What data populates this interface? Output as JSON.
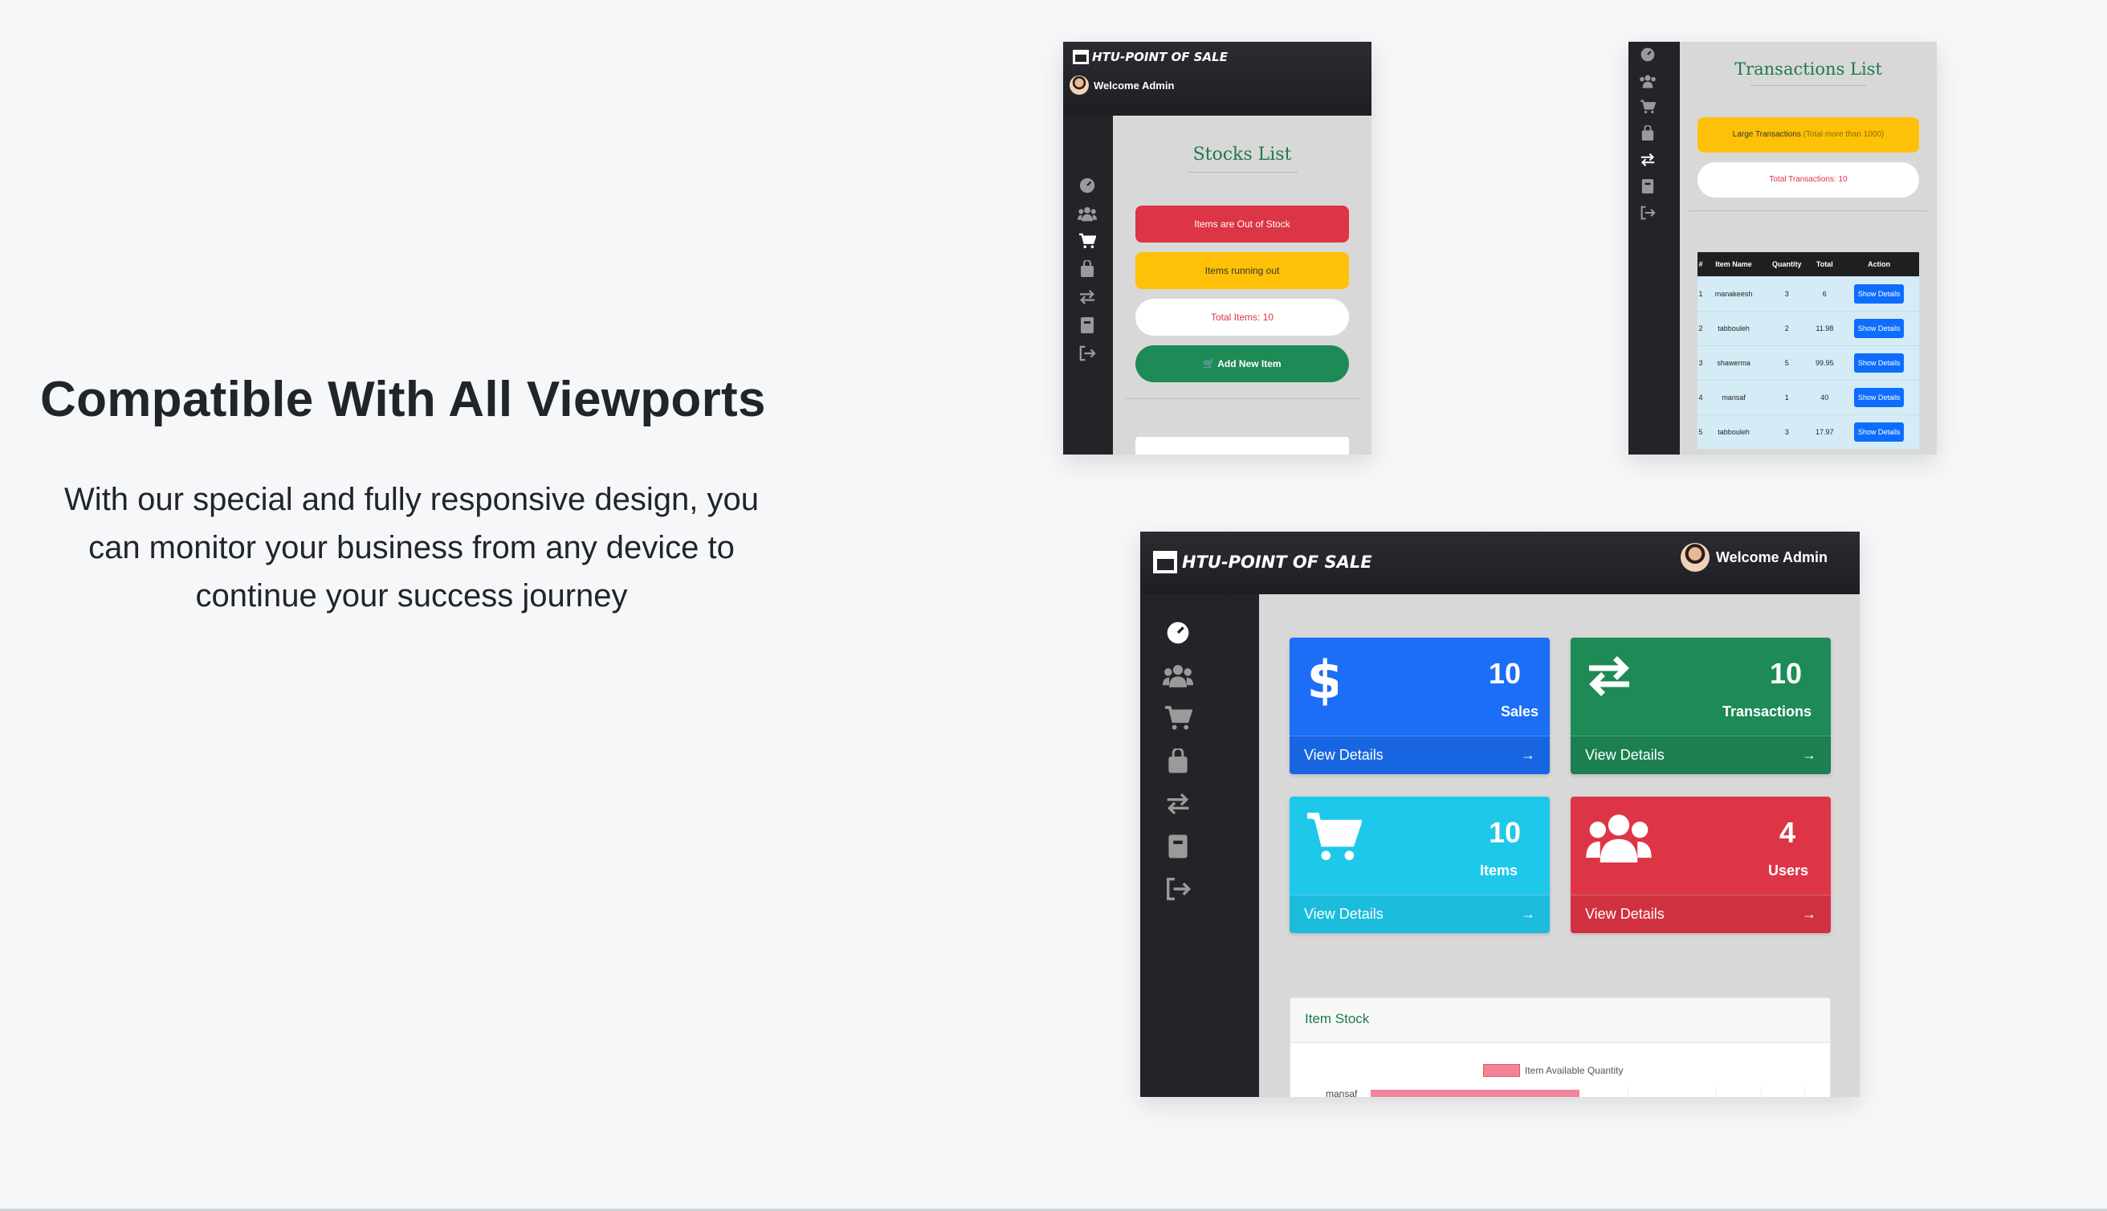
{
  "hero": {
    "title": "Compatible With All Viewports",
    "text": "With our special and fully responsive design, you can monitor your business from any device to continue your success journey"
  },
  "app": {
    "brand": "HTU-POINT OF SALE",
    "welcome": "Welcome Admin"
  },
  "stocks": {
    "title": "Stocks List",
    "out_of_stock": "Items are Out of Stock",
    "running_out": "Items running out",
    "total_items": "Total Items: 10",
    "add_new": "Add New Item"
  },
  "transactions": {
    "title": "Transactions List",
    "large": "Large Transactions",
    "large_note": "(Total more than 1000)",
    "total": "Total Transactions: 10",
    "columns": [
      "#",
      "Item Name",
      "Quantity",
      "Total",
      "Action"
    ],
    "rows": [
      {
        "n": "1",
        "name": "manakeesh",
        "qty": "3",
        "total": "6",
        "action": "Show Details"
      },
      {
        "n": "2",
        "name": "tabbouleh",
        "qty": "2",
        "total": "11.98",
        "action": "Show Details"
      },
      {
        "n": "3",
        "name": "shawerma",
        "qty": "5",
        "total": "99.95",
        "action": "Show Details"
      },
      {
        "n": "4",
        "name": "mansaf",
        "qty": "1",
        "total": "40",
        "action": "Show Details"
      },
      {
        "n": "5",
        "name": "tabbouleh",
        "qty": "3",
        "total": "17.97",
        "action": "Show Details"
      }
    ]
  },
  "dashboard": {
    "cards": [
      {
        "value": "10",
        "label": "Sales",
        "link": "View Details",
        "color": "#1b6ef5",
        "icon": "dollar-icon"
      },
      {
        "value": "10",
        "label": "Transactions",
        "link": "View Details",
        "color": "#1e8a56",
        "icon": "exchange-icon"
      },
      {
        "value": "10",
        "label": "Items",
        "link": "View Details",
        "color": "#1ec8eb",
        "icon": "cart-icon"
      },
      {
        "value": "4",
        "label": "Users",
        "link": "View Details",
        "color": "#dd3545",
        "icon": "users-icon"
      }
    ],
    "stock_panel": {
      "title": "Item Stock",
      "legend": "Item Available Quantity",
      "first_label": "mansaf"
    }
  },
  "colors": {
    "sidebar": "#222427",
    "danger": "#dc3545",
    "warning": "#ffc107",
    "success": "#198754",
    "primary": "#0d6efd",
    "title_green": "#1e7a4a"
  }
}
